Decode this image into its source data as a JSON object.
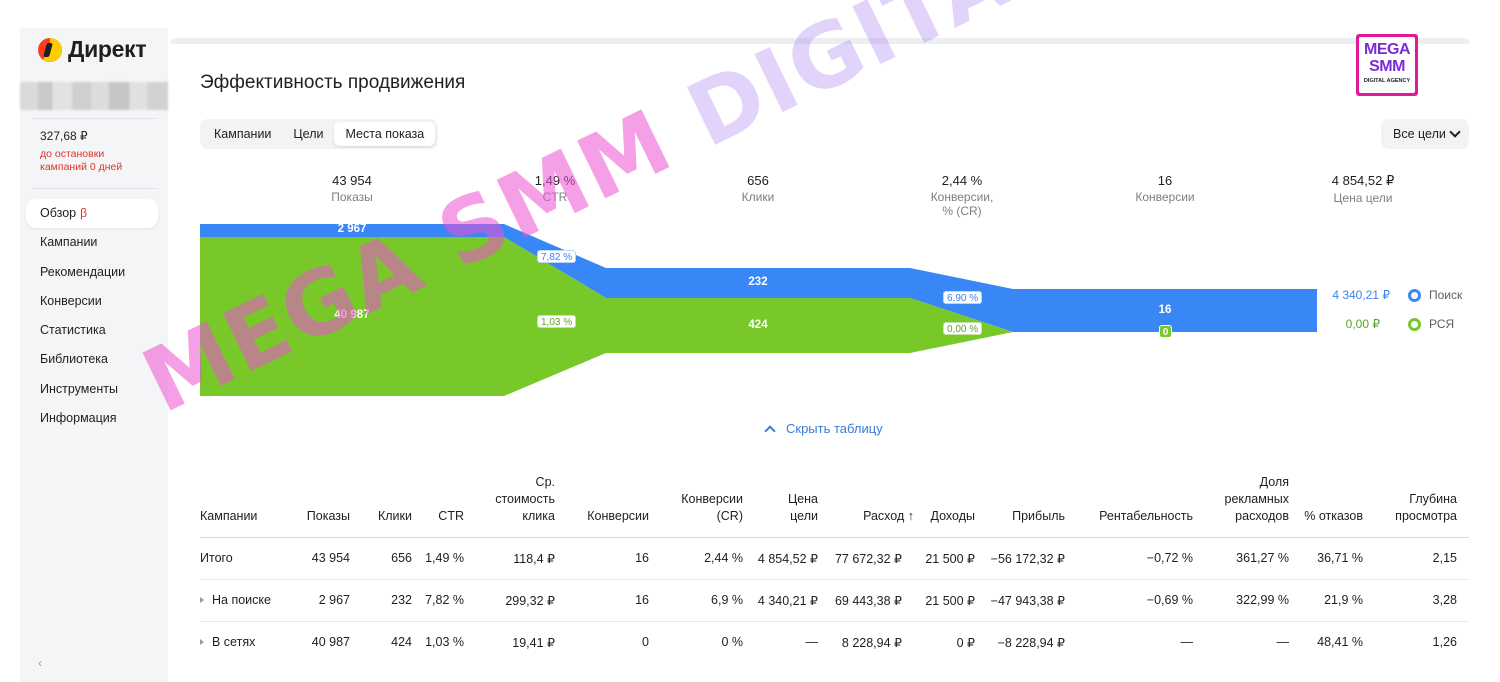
{
  "app": {
    "name": "Директ"
  },
  "sidebar": {
    "balance": "327,68 ₽",
    "balance_warning": "до остановки кампаний 0 дней",
    "items": [
      {
        "label": "Обзор",
        "badge": "β"
      },
      {
        "label": "Кампании"
      },
      {
        "label": "Рекомендации"
      },
      {
        "label": "Конверсии"
      },
      {
        "label": "Статистика"
      },
      {
        "label": "Библиотека"
      },
      {
        "label": "Инструменты"
      },
      {
        "label": "Информация"
      }
    ],
    "collapse": "‹"
  },
  "page": {
    "title": "Эффективность продвижения"
  },
  "tabs": [
    "Кампании",
    "Цели",
    "Места показа"
  ],
  "goal_select": "Все цели",
  "funnel": {
    "stats": [
      {
        "value": "43 954",
        "label": "Показы"
      },
      {
        "value": "1,49 %",
        "label": "CTR"
      },
      {
        "value": "656",
        "label": "Клики"
      },
      {
        "value": "2,44 %",
        "label": "Конверсии, % (CR)"
      },
      {
        "value": "16",
        "label": "Конверсии"
      },
      {
        "value": "4 854,52 ₽",
        "label": "Цена цели"
      }
    ],
    "search": {
      "impressions": "2 967",
      "ctr": "7,82 %",
      "clicks": "232",
      "cr": "6,90 %",
      "conversions": "16",
      "goal_price": "4 340,21 ₽",
      "name": "Поиск",
      "color": "#3987f6"
    },
    "network": {
      "impressions": "40 987",
      "ctr": "1,03 %",
      "clicks": "424",
      "cr": "0,00 %",
      "conversions": "0",
      "goal_price": "0,00 ₽",
      "name": "РСЯ",
      "color": "#79c82a"
    }
  },
  "hide_table": "Скрыть таблицу",
  "table": {
    "headers": [
      "Кампании",
      "Показы",
      "Клики",
      "CTR",
      "Ср. стоимость клика",
      "Конверсии",
      "Конверсии (CR)",
      "Цена цели",
      "Расход ↑",
      "Доходы",
      "Прибыль",
      "Рентабельность",
      "Доля рекламных расходов",
      "% отказов",
      "Глубина просмотра"
    ],
    "rows": [
      [
        "Итого",
        "43 954",
        "656",
        "1,49 %",
        "118,4 ₽",
        "16",
        "2,44 %",
        "4 854,52 ₽",
        "77 672,32 ₽",
        "21 500 ₽",
        "−56 172,32 ₽",
        "−0,72 %",
        "361,27 %",
        "36,71 %",
        "2,15"
      ],
      [
        "На поиске",
        "2 967",
        "232",
        "7,82 %",
        "299,32 ₽",
        "16",
        "6,9 %",
        "4 340,21 ₽",
        "69 443,38 ₽",
        "21 500 ₽",
        "−47 943,38 ₽",
        "−0,69 %",
        "322,99 %",
        "21,9 %",
        "3,28"
      ],
      [
        "В сетях",
        "40 987",
        "424",
        "1,03 %",
        "19,41 ₽",
        "0",
        "0 %",
        "—",
        "8 228,94 ₽",
        "0 ₽",
        "−8 228,94 ₽",
        "—",
        "—",
        "48,41 %",
        "1,26"
      ]
    ]
  },
  "badge": {
    "line1": "MEGA",
    "line2": "SMM",
    "line3": "DIGITAL AGENCY"
  },
  "watermark": {
    "part1": "MEGA SMM",
    "part2": " DIGITAL AGENCY"
  }
}
